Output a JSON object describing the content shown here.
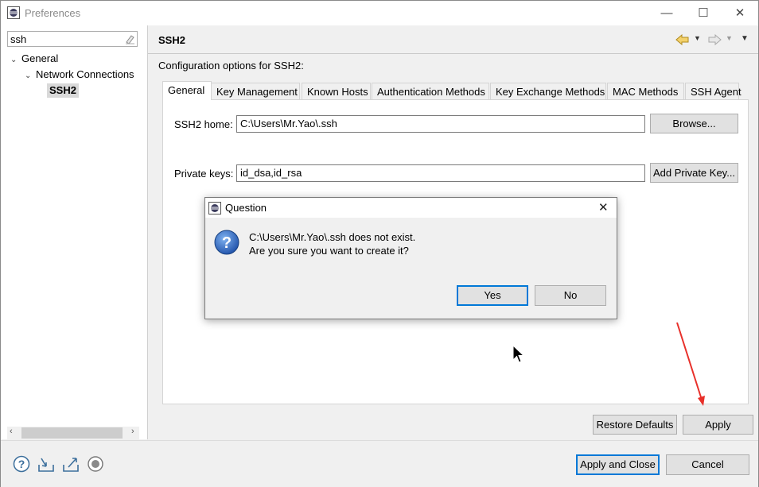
{
  "window": {
    "title": "Preferences",
    "controls": {
      "minimize": "—",
      "maximize": "☐",
      "close": "✕"
    }
  },
  "sidebar": {
    "search_value": "ssh",
    "tree": [
      {
        "label": "General",
        "expanded": true
      },
      {
        "label": "Network Connections",
        "expanded": true
      },
      {
        "label": "SSH2",
        "selected": true
      }
    ]
  },
  "page": {
    "title": "SSH2",
    "description": "Configuration options for SSH2:",
    "tabs": [
      {
        "label": "General",
        "selected": true
      },
      {
        "label": "Key Management"
      },
      {
        "label": "Known Hosts"
      },
      {
        "label": "Authentication Methods"
      },
      {
        "label": "Key Exchange Methods"
      },
      {
        "label": "MAC Methods"
      },
      {
        "label": "SSH Agent"
      }
    ],
    "ssh2_home": {
      "label": "SSH2 home:",
      "value": "C:\\Users\\Mr.Yao\\.ssh",
      "browse_label": "Browse..."
    },
    "private_keys": {
      "label": "Private keys:",
      "value": "id_dsa,id_rsa",
      "add_label": "Add Private Key..."
    },
    "restore_defaults_label": "Restore Defaults",
    "apply_label": "Apply"
  },
  "footer": {
    "apply_close_label": "Apply and Close",
    "cancel_label": "Cancel",
    "icons": [
      "help-icon",
      "import-icon",
      "export-icon",
      "record-icon"
    ]
  },
  "dialog": {
    "title": "Question",
    "close": "✕",
    "message_line1": "C:\\Users\\Mr.Yao\\.ssh does not exist.",
    "message_line2": "Are you sure you want to create it?",
    "yes_label": "Yes",
    "no_label": "No"
  },
  "colors": {
    "accent": "#0078d7",
    "annotation": "#e8302a",
    "selection": "#d9d9d9"
  }
}
